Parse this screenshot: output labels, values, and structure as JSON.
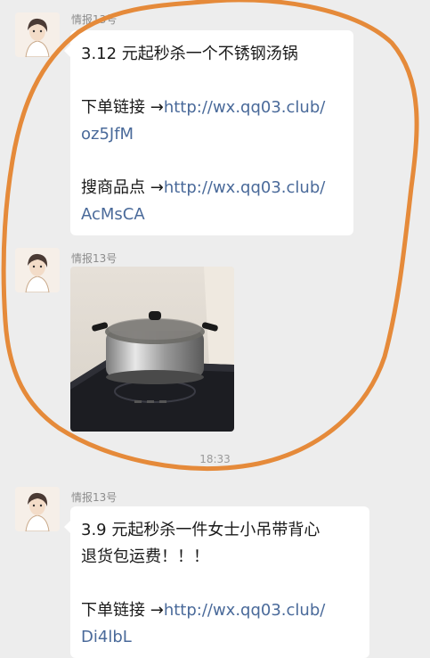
{
  "messages": [
    {
      "sender": "情报13号",
      "text1": "3.12 元起秒杀一个不锈钢汤锅",
      "order_prefix": "下单链接 →",
      "order_link_a": "http://wx.qq03.club/",
      "order_link_b": "oz5JfM",
      "search_prefix": "搜商品点 →",
      "search_link_a": "http://wx.qq03.club/",
      "search_link_b": "AcMsCA"
    },
    {
      "sender": "情报13号",
      "image_alt": "不锈钢汤锅"
    },
    {
      "sender": "情报13号",
      "text1": "3.9 元起秒杀一件女士小吊带背心",
      "text2": "退货包运费！！！",
      "order_prefix": "下单链接 →",
      "order_link_a": "http://wx.qq03.club/",
      "order_link_b": "Di4lbL"
    }
  ],
  "timestamp": "18:33",
  "annotation_color": "#e58a3a",
  "link_color": "#4a6a9a"
}
